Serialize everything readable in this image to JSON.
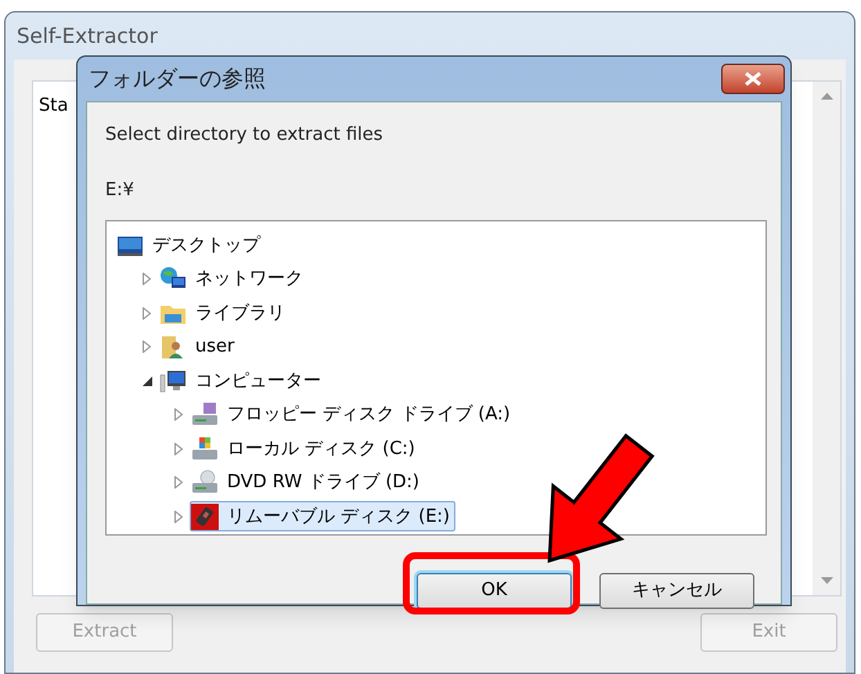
{
  "window": {
    "title": "Self-Extractor",
    "log_text": "Sta",
    "buttons": [
      {
        "label": "Extract",
        "disabled": true
      },
      {
        "label": "Exit",
        "disabled": true
      }
    ]
  },
  "dialog": {
    "title": "フォルダーの参照",
    "message": "Select directory to extract files",
    "path": "E:¥",
    "tree": [
      {
        "label": "デスクトップ",
        "kind": "desktop",
        "selected": false,
        "children": [
          {
            "label": "ネットワーク",
            "kind": "network",
            "expanded": false,
            "selected": false
          },
          {
            "label": "ライブラリ",
            "kind": "library",
            "expanded": false,
            "selected": false
          },
          {
            "label": "user",
            "kind": "userfolder",
            "expanded": false,
            "selected": false
          },
          {
            "label": "コンピューター",
            "kind": "computer",
            "expanded": true,
            "selected": false,
            "children": [
              {
                "label": "フロッピー ディスク ドライブ (A:)",
                "kind": "floppy",
                "expanded": false,
                "selected": false
              },
              {
                "label": "ローカル ディスク (C:)",
                "kind": "localdisk",
                "expanded": false,
                "selected": false
              },
              {
                "label": "DVD RW ドライブ (D:)",
                "kind": "dvd",
                "expanded": false,
                "selected": false
              },
              {
                "label": "リムーバブル ディスク (E:)",
                "kind": "removable",
                "expanded": false,
                "selected": true
              }
            ]
          }
        ]
      }
    ],
    "buttons": [
      {
        "label": "OK",
        "highlighted": true
      },
      {
        "label": "キャンセル",
        "highlighted": false
      }
    ]
  }
}
